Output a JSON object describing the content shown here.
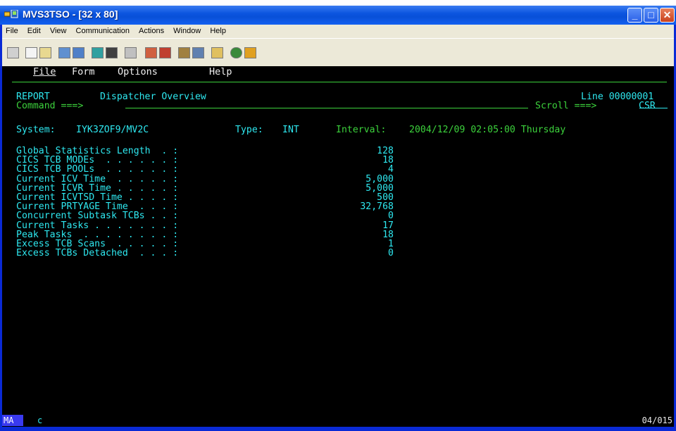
{
  "window": {
    "title": "MVS3TSO - [32 x 80]",
    "minimize_glyph": "_",
    "maximize_glyph": "□",
    "close_glyph": "✕"
  },
  "menubar": {
    "file": "File",
    "edit": "Edit",
    "view": "View",
    "communication": "Communication",
    "actions": "Actions",
    "window": "Window",
    "help": "Help"
  },
  "toolbar": {
    "icons": [
      "print-screen-icon",
      "copy-icon",
      "paste-icon",
      "send-icon",
      "receive-icon",
      "display-icon",
      "keypad-icon",
      "macro-icon",
      "record-icon",
      "playback-icon",
      "record-stop-icon",
      "clipboard-icon",
      "list-icon",
      "globe-icon",
      "edit-icon"
    ]
  },
  "terminal": {
    "menu": {
      "file": "File",
      "form": "Form",
      "options": "Options",
      "help": "Help"
    },
    "report_label": "REPORT",
    "report_title": "Dispatcher Overview",
    "line_label": "Line 00000001",
    "command_label": "Command ===>",
    "command_value": "",
    "scroll_label": "Scroll ===>",
    "scroll_value": "CSR",
    "system_label": "System:",
    "system_value": "IYK3ZOF9/MV2C",
    "type_label": "Type:",
    "type_value": "INT",
    "interval_label": "Interval:",
    "interval_value": "2004/12/09 02:05:00 Thursday",
    "stats": [
      {
        "label": "Global Statistics Length  . :",
        "value": "128"
      },
      {
        "label": "CICS TCB MODEs  . . . . . . :",
        "value": "18"
      },
      {
        "label": "CICS TCB POOLs  . . . . . . :",
        "value": "4"
      },
      {
        "label": "Current ICV Time  . . . . . :",
        "value": "5,000"
      },
      {
        "label": "Current ICVR Time . . . . . :",
        "value": "5,000"
      },
      {
        "label": "Current ICVTSD Time . . . . :",
        "value": "500"
      },
      {
        "label": "Current PRTYAGE Time  . . . :",
        "value": "32,768"
      },
      {
        "label": "Concurrent Subtask TCBs . . :",
        "value": "0"
      },
      {
        "label": "Current Tasks . . . . . . . :",
        "value": "17"
      },
      {
        "label": "Peak Tasks  . . . . . . . . :",
        "value": "18"
      },
      {
        "label": "Excess TCB Scans  . . . . . :",
        "value": "1"
      },
      {
        "label": "Excess TCBs Detached  . . . :",
        "value": "0"
      }
    ]
  },
  "status": {
    "mode": "MA",
    "indicator": "c",
    "cursor_position": "04/015"
  }
}
